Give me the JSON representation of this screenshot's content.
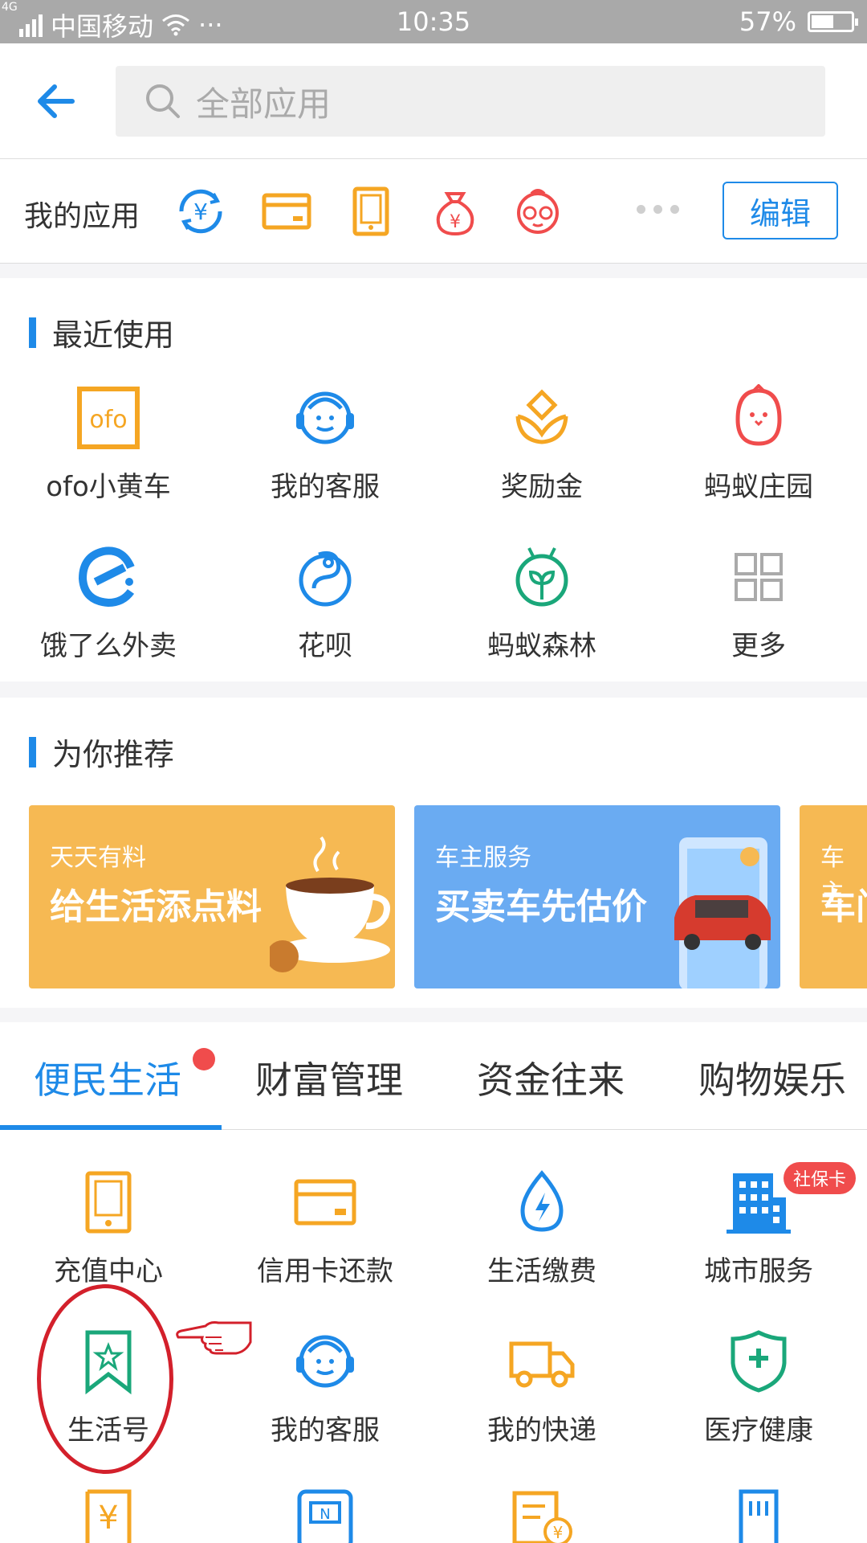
{
  "status_bar": {
    "network": "4G",
    "carrier": "中国移动",
    "time": "10:35",
    "battery": "57%",
    "battery_level": 0.57
  },
  "search": {
    "placeholder": "全部应用"
  },
  "my_apps": {
    "title": "我的应用",
    "icons": [
      "transfer-icon",
      "card-icon",
      "phone-icon",
      "money-bag-icon",
      "mascot-icon"
    ],
    "edit_label": "编辑"
  },
  "recent": {
    "title": "最近使用",
    "items": [
      {
        "label": "ofo小黄车",
        "icon": "ofo-icon"
      },
      {
        "label": "我的客服",
        "icon": "customer-service-icon"
      },
      {
        "label": "奖励金",
        "icon": "reward-icon"
      },
      {
        "label": "蚂蚁庄园",
        "icon": "chick-icon"
      },
      {
        "label": "饿了么外卖",
        "icon": "eleme-icon"
      },
      {
        "label": "花呗",
        "icon": "huabei-icon"
      },
      {
        "label": "蚂蚁森林",
        "icon": "forest-icon"
      },
      {
        "label": "更多",
        "icon": "more-grid-icon"
      }
    ]
  },
  "recommend": {
    "title": "为你推荐",
    "banners": [
      {
        "sub": "天天有料",
        "main": "给生活添点料"
      },
      {
        "sub": "车主服务",
        "main": "买卖车先估价"
      },
      {
        "sub": "车主",
        "main": "车门"
      }
    ]
  },
  "tabs": [
    "便民生活",
    "财富管理",
    "资金往来",
    "购物娱乐"
  ],
  "services": {
    "items": [
      {
        "label": "充值中心",
        "icon": "phone-icon"
      },
      {
        "label": "信用卡还款",
        "icon": "credit-card-icon"
      },
      {
        "label": "生活缴费",
        "icon": "water-bolt-icon"
      },
      {
        "label": "城市服务",
        "icon": "building-icon",
        "badge": "社保卡"
      },
      {
        "label": "生活号",
        "icon": "bookmark-star-icon"
      },
      {
        "label": "我的客服",
        "icon": "customer-service-icon"
      },
      {
        "label": "我的快递",
        "icon": "truck-icon"
      },
      {
        "label": "医疗健康",
        "icon": "medical-shield-icon"
      }
    ]
  },
  "colors": {
    "accent": "#1e8ae8",
    "orange": "#f5a623",
    "red": "#f04c4c",
    "green": "#1aa77a"
  }
}
